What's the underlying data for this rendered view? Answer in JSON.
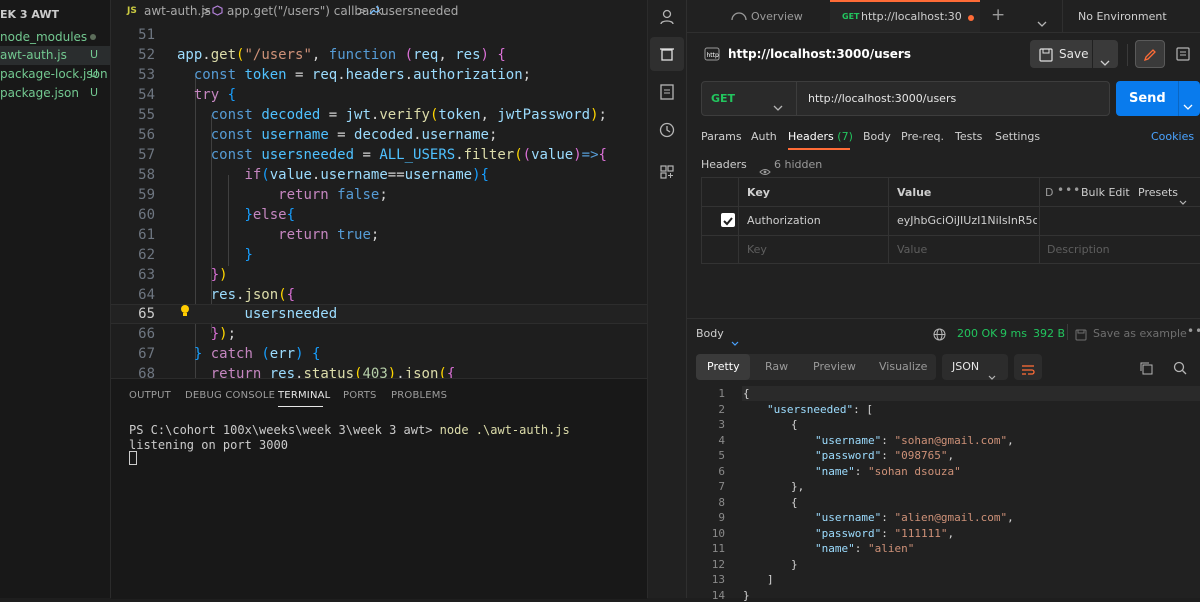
{
  "explorer": {
    "title": "EK 3 AWT",
    "files": [
      {
        "name": "node_modules",
        "status": ""
      },
      {
        "name": "awt-auth.js",
        "status": "U"
      },
      {
        "name": "package-lock.json",
        "status": "U"
      },
      {
        "name": "package.json",
        "status": "U"
      }
    ]
  },
  "editor": {
    "breadcrumb": {
      "js_badge": "JS",
      "file": "awt-auth.js",
      "sep": ">",
      "callback": "app.get(\"/users\") callback",
      "symbol": "usersneeded"
    },
    "line_numbers": [
      "51",
      "52",
      "53",
      "54",
      "55",
      "56",
      "57",
      "58",
      "59",
      "60",
      "61",
      "62",
      "63",
      "64",
      "65",
      "66",
      "67",
      "68"
    ],
    "current_line": "65"
  },
  "panel": {
    "tabs": [
      "OUTPUT",
      "DEBUG CONSOLE",
      "TERMINAL",
      "PORTS",
      "PROBLEMS"
    ],
    "active_tab": "TERMINAL",
    "prompt": "PS C:\\cohort 100x\\weeks\\week 3\\week 3 awt> ",
    "command": "node .\\awt-auth.js",
    "output": "listening on port 3000"
  },
  "postman": {
    "tabs": {
      "overview": "Overview",
      "active_method": "GET",
      "active_url": "http://localhost:3000/u",
      "add": "+",
      "environment": "No Environment"
    },
    "request": {
      "title": "http://localhost:3000/users",
      "save_label": "Save",
      "method": "GET",
      "url": "http://localhost:3000/users",
      "send_label": "Send"
    },
    "req_tabs": {
      "params": "Params",
      "auth": "Auth",
      "headers": "Headers",
      "headers_count": "(7)",
      "body": "Body",
      "prereq": "Pre-req.",
      "tests": "Tests",
      "settings": "Settings",
      "cookies": "Cookies"
    },
    "headers": {
      "label": "Headers",
      "hidden": "6 hidden",
      "col_key": "Key",
      "col_value": "Value",
      "col_desc_trunc": "D",
      "bulk_edit": "Bulk Edit",
      "presets": "Presets",
      "rows": [
        {
          "checked": true,
          "key": "Authorization",
          "value": "eyJhbGciOiJIUzI1NiIsInR5c..."
        }
      ],
      "placeholder_key": "Key",
      "placeholder_value": "Value",
      "placeholder_desc": "Description"
    },
    "response": {
      "body_label": "Body",
      "status": "200 OK",
      "time": "9 ms",
      "size": "392 B",
      "save_example": "Save as example",
      "view_tabs": [
        "Pretty",
        "Raw",
        "Preview",
        "Visualize"
      ],
      "active_view": "Pretty",
      "format": "JSON"
    },
    "response_json": {
      "line_numbers": [
        "1",
        "2",
        "3",
        "4",
        "5",
        "6",
        "7",
        "8",
        "9",
        "10",
        "11",
        "12",
        "13",
        "14"
      ],
      "root_key": "usersneeded",
      "users": [
        {
          "username": "sohan@gmail.com",
          "password": "098765",
          "name": "sohan dsouza"
        },
        {
          "username": "alien@gmail.com",
          "password": "111111",
          "name": "alien"
        }
      ]
    }
  },
  "colors": {
    "vscode_bg": "#1e1e1e",
    "postman_bg": "#212121",
    "send_blue": "#097bed",
    "postman_orange": "#ff6c37",
    "untracked_green": "#73c991"
  }
}
